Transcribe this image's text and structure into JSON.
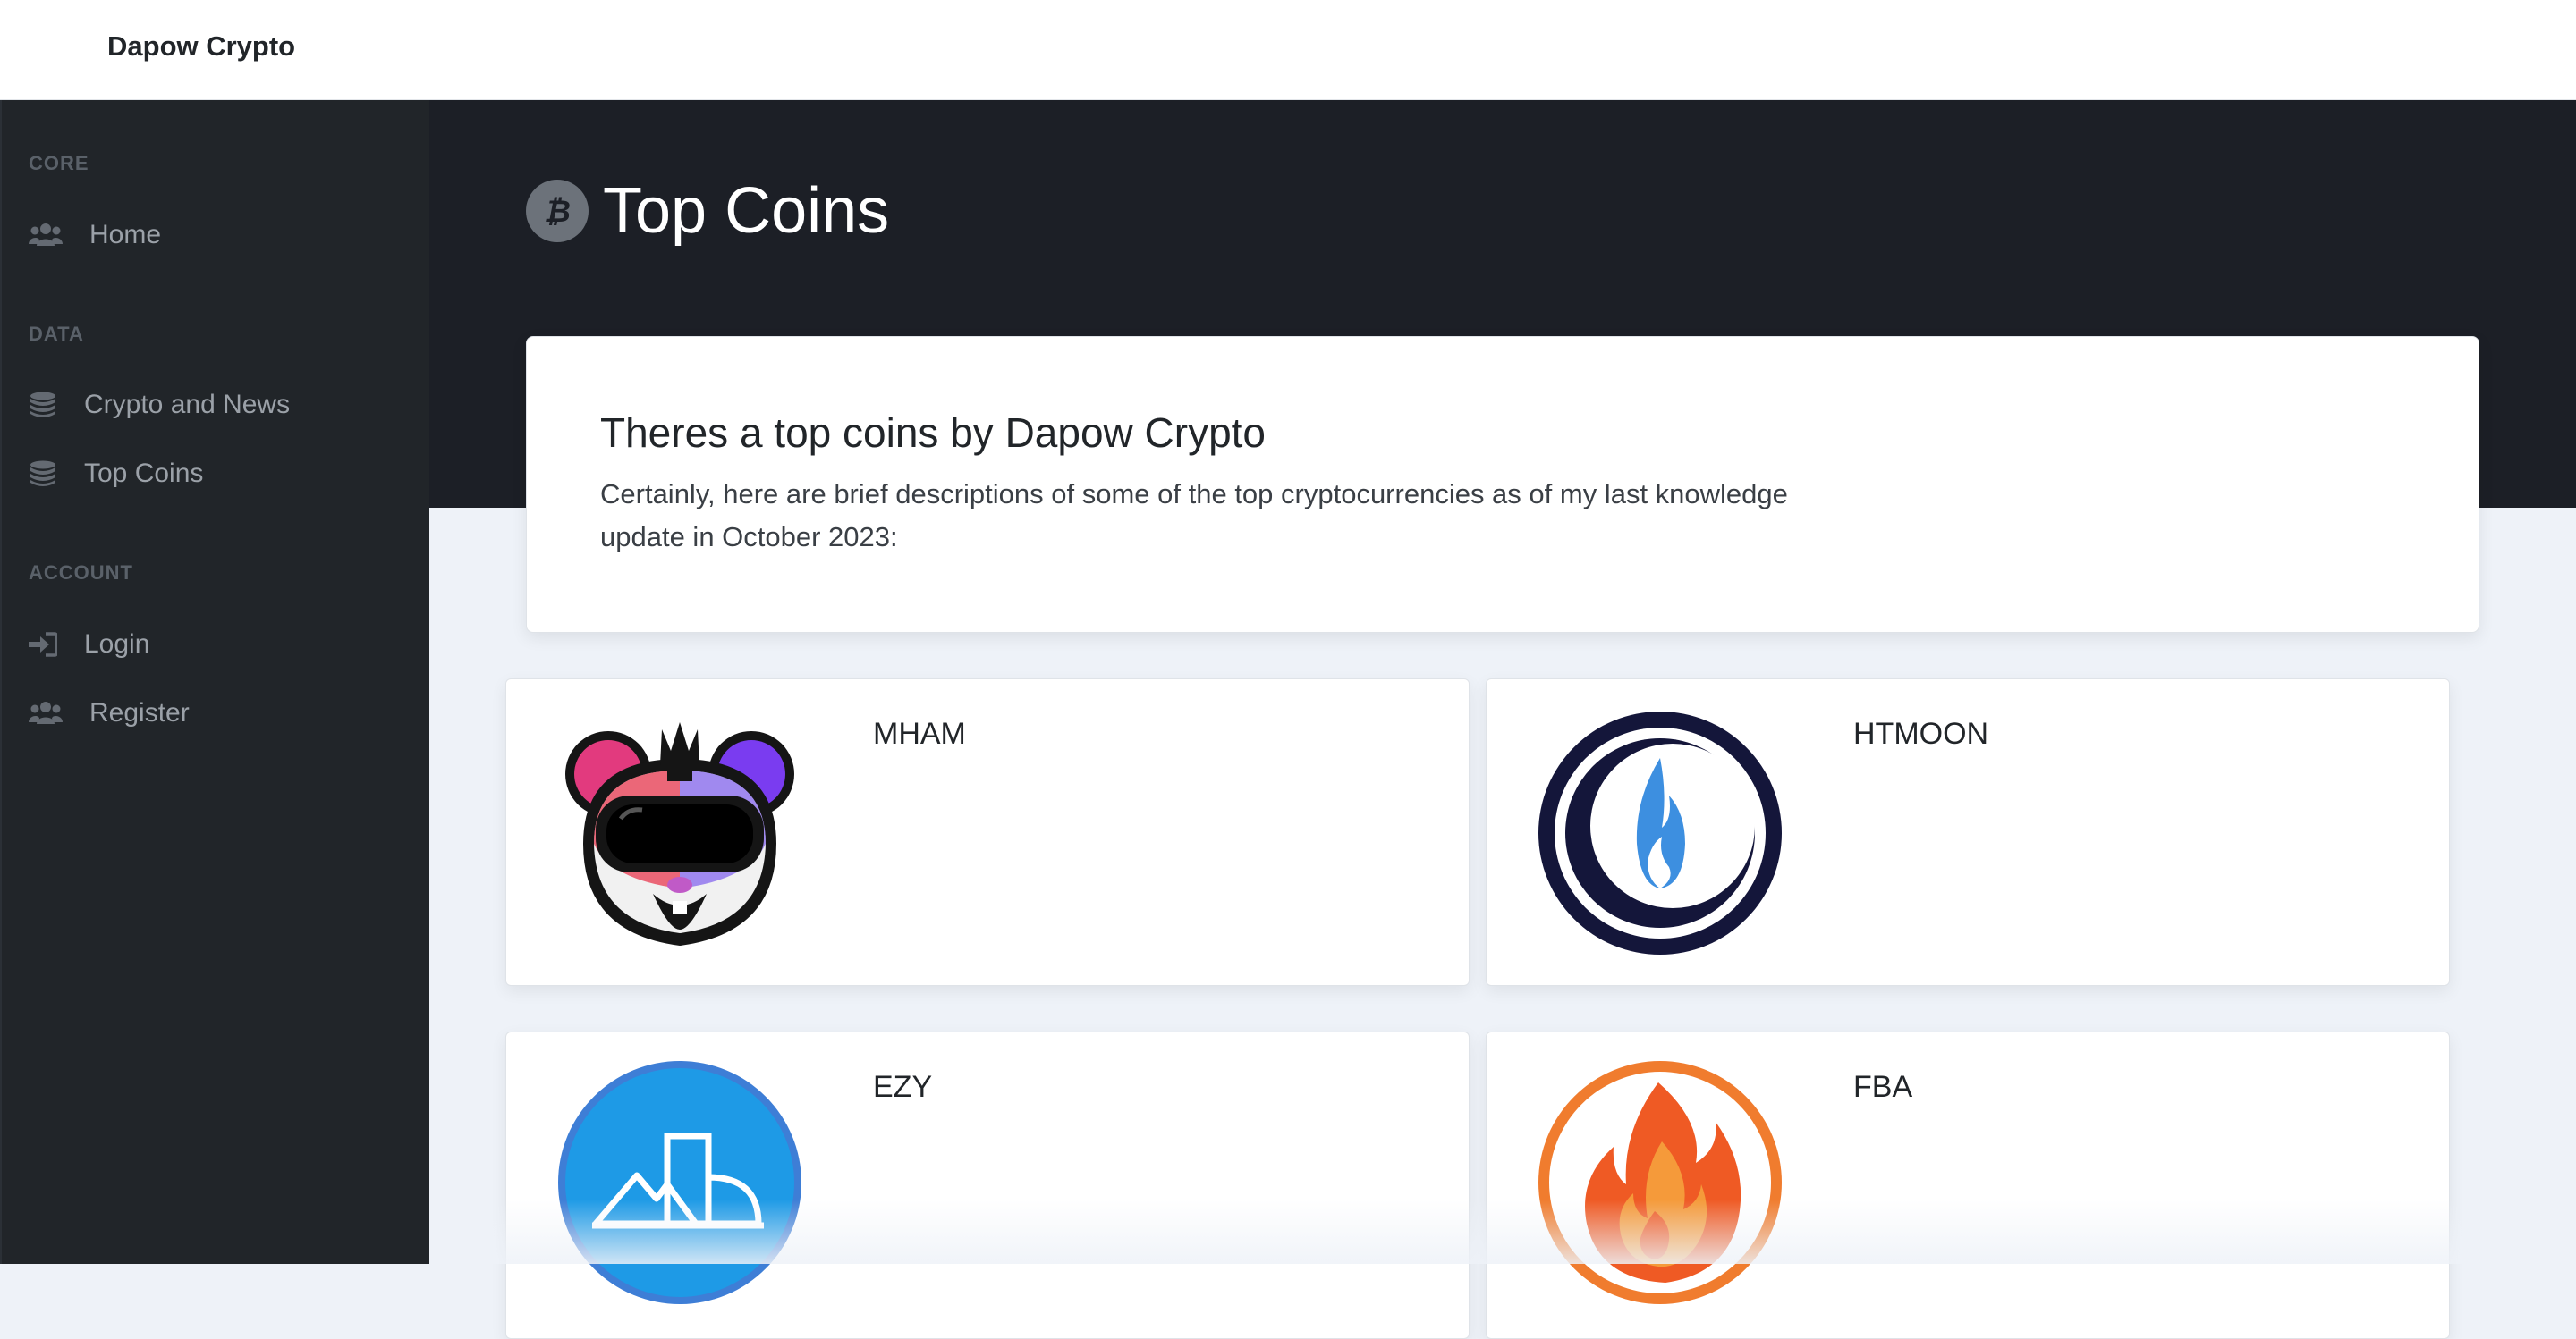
{
  "brand": "Dapow Crypto",
  "sidebar": {
    "sections": [
      {
        "heading": "CORE",
        "items": [
          {
            "label": "Home",
            "icon": "users-icon"
          }
        ]
      },
      {
        "heading": "DATA",
        "items": [
          {
            "label": "Crypto and News",
            "icon": "coins-icon"
          },
          {
            "label": "Top Coins",
            "icon": "coins-icon"
          }
        ]
      },
      {
        "heading": "ACCOUNT",
        "items": [
          {
            "label": "Login",
            "icon": "sign-in-icon"
          },
          {
            "label": "Register",
            "icon": "users-icon"
          }
        ]
      }
    ]
  },
  "header": {
    "title": "Top Coins",
    "icon": "bitcoin-icon"
  },
  "info": {
    "title": "Theres a top coins by Dapow Crypto",
    "description": "Certainly, here are brief descriptions of some of the top cryptocurrencies as of my last knowledge update in October 2023:"
  },
  "coins": [
    {
      "name": "MHAM",
      "icon": "hamster-vr-logo"
    },
    {
      "name": "HTMOON",
      "icon": "blue-flame-moon-logo"
    },
    {
      "name": "EZY",
      "icon": "mountain-logo"
    },
    {
      "name": "FBA",
      "icon": "orange-flame-logo"
    }
  ],
  "colors": {
    "sidebar_bg": "#212529",
    "hero_bg": "#1c1f26",
    "page_bg": "#eef2f8",
    "card_bg": "#ffffff"
  }
}
